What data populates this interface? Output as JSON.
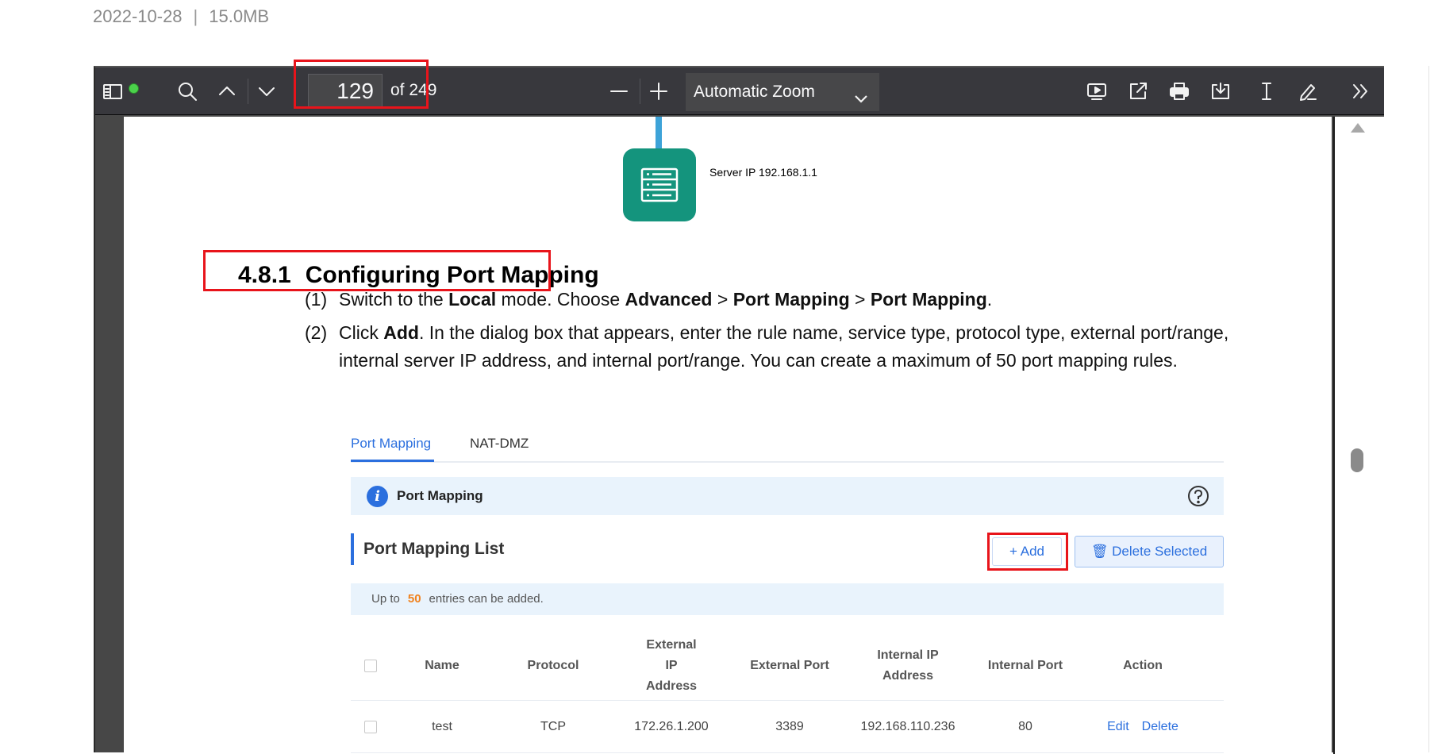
{
  "file_meta": {
    "date": "2022-10-28",
    "separator": "|",
    "size": "15.0MB"
  },
  "toolbar": {
    "page_number": "129",
    "page_total": "of 249",
    "zoom": "Automatic Zoom",
    "icons": [
      "sidebar-toggle-icon",
      "search-icon",
      "previous-page-icon",
      "next-page-icon",
      "zoom-out-icon",
      "zoom-in-icon",
      "chevron-down-icon",
      "presentation-icon",
      "open-external-icon",
      "print-icon",
      "download-icon",
      "text-select-icon",
      "draw-icon",
      "more-tools-icon"
    ]
  },
  "document": {
    "server_label": "Server IP 192.168.1.1",
    "heading_number": "4.8.1",
    "heading_text": "Configuring Port Mapping",
    "step1": {
      "num": "(1)",
      "a": "Switch to the ",
      "b": "Local",
      "c": " mode. Choose ",
      "d": "Advanced",
      "e": " > ",
      "f": "Port Mapping",
      "g": " > ",
      "h": "Port Mapping",
      "i": "."
    },
    "step2": {
      "num": "(2)",
      "a": "Click ",
      "b": "Add",
      "c": ". In the dialog box that appears, enter the rule name, service type, protocol type, external port/range,",
      "line2": "internal server IP address, and internal port/range. You can create a maximum of 50 port mapping rules."
    }
  },
  "screenshot": {
    "tabs": [
      "Port Mapping",
      "NAT-DMZ"
    ],
    "info_title": "Port Mapping",
    "list_title": "Port Mapping List",
    "add_label": "+ Add",
    "delete_selected_label": "Delete Selected",
    "limit_prefix": "Up to",
    "limit_value": "50",
    "limit_suffix": "entries can be added.",
    "columns": [
      "Name",
      "Protocol",
      "External IP Address",
      "External Port",
      "Internal IP Address",
      "Internal Port",
      "Action"
    ],
    "rows": [
      {
        "name": "test",
        "protocol": "TCP",
        "external_ip": "172.26.1.200",
        "external_port": "3389",
        "internal_ip": "192.168.110.236",
        "internal_port": "80",
        "edit": "Edit",
        "delete": "Delete"
      }
    ]
  },
  "colors": {
    "highlight_box": "#e8141b",
    "accent": "#2b6fde",
    "toolbar_bg": "#38383d",
    "server_icon": "#14947d"
  }
}
